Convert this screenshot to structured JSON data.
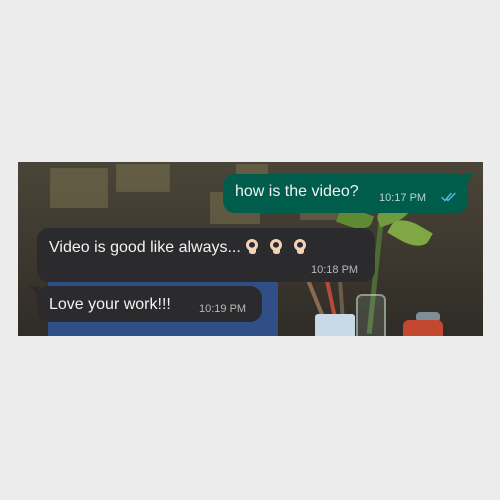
{
  "messages": [
    {
      "direction": "outgoing",
      "text": "how is the video?",
      "time": "10:17 PM",
      "status": "double-check-read",
      "status_icon": "double-check-icon",
      "status_color": "#53bdeb"
    },
    {
      "direction": "incoming",
      "text": "Video is good like always...",
      "emojis": [
        "ok-hand-emoji",
        "ok-hand-emoji",
        "ok-hand-emoji"
      ],
      "time": "10:18 PM"
    },
    {
      "direction": "incoming",
      "text": "Love your work!!!",
      "time": "10:19 PM"
    }
  ],
  "colors": {
    "outgoing_bubble": "#005c4b",
    "incoming_bubble": "#2b2b2d",
    "page_background": "#ececed"
  }
}
